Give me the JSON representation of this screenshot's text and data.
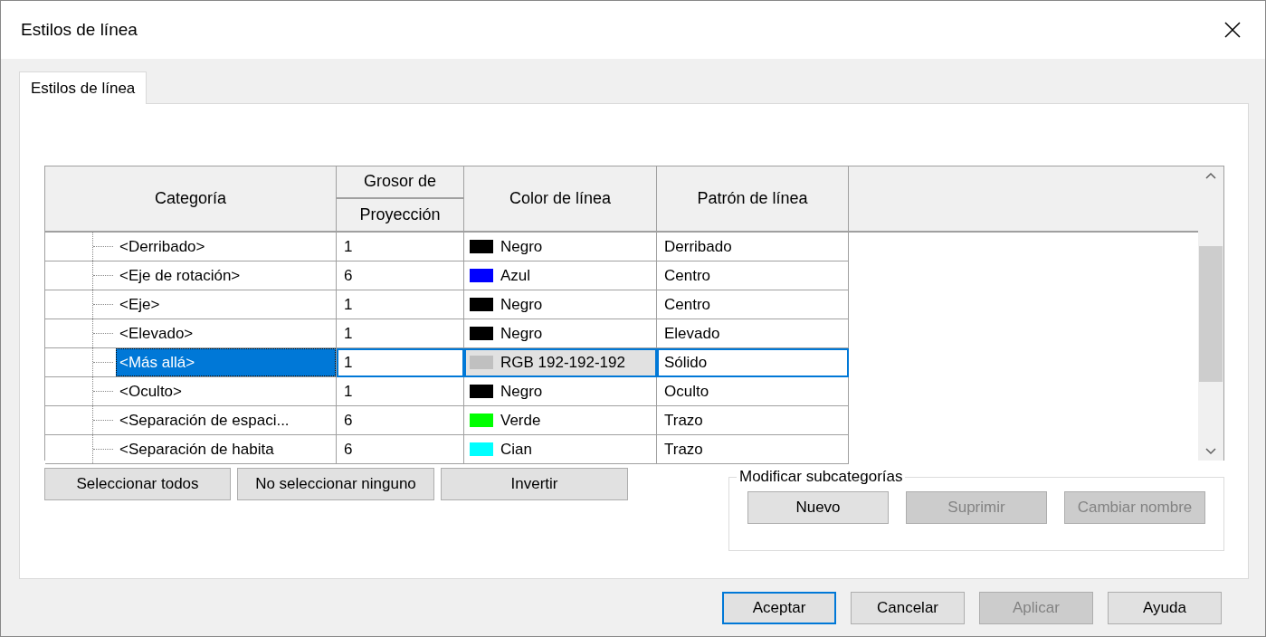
{
  "window": {
    "title": "Estilos de línea"
  },
  "tabs": [
    {
      "label": "Estilos de línea",
      "selected": true
    }
  ],
  "table": {
    "columns": {
      "category": "Categoría",
      "thickness_group": "Grosor de",
      "thickness": "Proyección",
      "line_color": "Color de línea",
      "pattern": "Patrón de línea"
    },
    "rows": [
      {
        "category": "<Derribado>",
        "thickness": "1",
        "color_name": "Negro",
        "color": "#000000",
        "pattern": "Derribado",
        "selected": false
      },
      {
        "category": "<Eje de rotación>",
        "thickness": "6",
        "color_name": "Azul",
        "color": "#0000ff",
        "pattern": "Centro",
        "selected": false
      },
      {
        "category": "<Eje>",
        "thickness": "1",
        "color_name": "Negro",
        "color": "#000000",
        "pattern": "Centro",
        "selected": false
      },
      {
        "category": "<Elevado>",
        "thickness": "1",
        "color_name": "Negro",
        "color": "#000000",
        "pattern": "Elevado",
        "selected": false
      },
      {
        "category": "<Más allá>",
        "thickness": "1",
        "color_name": "RGB 192-192-192",
        "color": "#c0c0c0",
        "pattern": "Sólido",
        "selected": true
      },
      {
        "category": "<Oculto>",
        "thickness": "1",
        "color_name": "Negro",
        "color": "#000000",
        "pattern": "Oculto",
        "selected": false
      },
      {
        "category": "<Separación de espaci...",
        "thickness": "6",
        "color_name": "Verde",
        "color": "#00ff00",
        "pattern": "Trazo",
        "selected": false
      },
      {
        "category": "<Separación de habita",
        "thickness": "6",
        "color_name": "Cian",
        "color": "#00ffff",
        "pattern": "Trazo",
        "selected": false
      }
    ]
  },
  "selection_buttons": [
    {
      "label": "Seleccionar todos"
    },
    {
      "label": "No seleccionar ninguno"
    },
    {
      "label": "Invertir"
    }
  ],
  "subcategories": {
    "title": "Modificar subcategorías",
    "buttons": [
      {
        "label": "Nuevo",
        "disabled": false
      },
      {
        "label": "Suprimir",
        "disabled": true
      },
      {
        "label": "Cambiar nombre",
        "disabled": true
      }
    ]
  },
  "footer_buttons": [
    {
      "label": "Aceptar",
      "disabled": false,
      "default": true
    },
    {
      "label": "Cancelar",
      "disabled": false,
      "default": false
    },
    {
      "label": "Aplicar",
      "disabled": true,
      "default": false
    },
    {
      "label": "Ayuda",
      "disabled": false,
      "default": false
    }
  ]
}
